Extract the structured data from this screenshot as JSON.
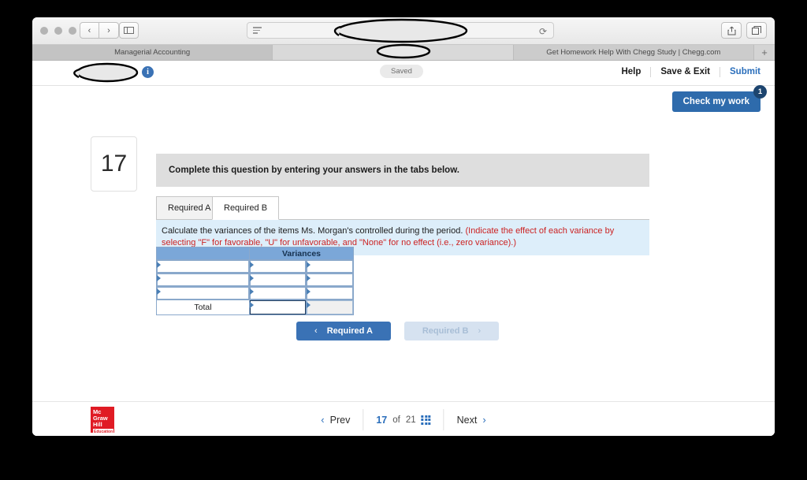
{
  "browser": {
    "traffic_lights": [
      "close",
      "minimize",
      "zoom"
    ],
    "back_label": "‹",
    "forward_label": "›",
    "sidebar_icon": "sidebar-icon",
    "url_text": "",
    "reload_icon": "reload-icon",
    "share_icon": "share-icon",
    "tabs_icon": "show-tabs-icon",
    "new_tab_label": "+",
    "tabs": [
      {
        "title": "Managerial Accounting",
        "state": "active"
      },
      {
        "title": "",
        "state": "blank"
      },
      {
        "title": "Get Homework Help With Chegg Study | Chegg.com",
        "state": "inactive"
      }
    ]
  },
  "header": {
    "title_redacted": true,
    "info_icon_label": "i",
    "saved_label": "Saved",
    "links": [
      "Help",
      "Save & Exit",
      "Submit"
    ],
    "check_my_work": {
      "label": "Check my work",
      "badge": "1"
    }
  },
  "question": {
    "number": "17",
    "instruction": "Complete this question by entering your answers in the tabs below.",
    "tabs": [
      {
        "label": "Required A",
        "active": false
      },
      {
        "label": "Required B",
        "active": true
      }
    ],
    "note_main": "Calculate the variances of the items Ms. Morgan's controlled during the period.",
    "note_hint": "(Indicate the effect of each variance by selecting \"F\" for favorable, \"U\" for unfavorable, and \"None\" for no effect (i.e., zero variance).)"
  },
  "answer_table": {
    "header_blank": "",
    "header_variances": "Variances",
    "rows": [
      {
        "label": "",
        "col_a": "",
        "col_b": "",
        "type": "input"
      },
      {
        "label": "",
        "col_a": "",
        "col_b": "",
        "type": "input"
      },
      {
        "label": "",
        "col_a": "",
        "col_b": "",
        "type": "input"
      },
      {
        "label": "Total",
        "col_a": "",
        "col_b": "",
        "type": "total"
      }
    ]
  },
  "required_nav": {
    "prev": {
      "label": "Required A",
      "chevron": "‹",
      "enabled": true
    },
    "next": {
      "label": "Required B",
      "chevron": "›",
      "enabled": false
    }
  },
  "footer": {
    "logo": {
      "line1": "Mc",
      "line2": "Graw",
      "line3": "Hill",
      "line4": "Education",
      "color": "#e01b24"
    },
    "prev_label": "Prev",
    "prev_chevron": "‹",
    "current_page": "17",
    "of_label": "of",
    "total_pages": "21",
    "grid_icon": "grid-view-icon",
    "next_label": "Next",
    "next_chevron": "›"
  },
  "colors": {
    "accent_blue": "#2a6ebb",
    "button_blue": "#3a72b5",
    "table_header_blue": "#7ba7d8",
    "note_blue": "#ddeefa",
    "hint_red": "#cc2222",
    "instruction_gray": "#dedede"
  }
}
